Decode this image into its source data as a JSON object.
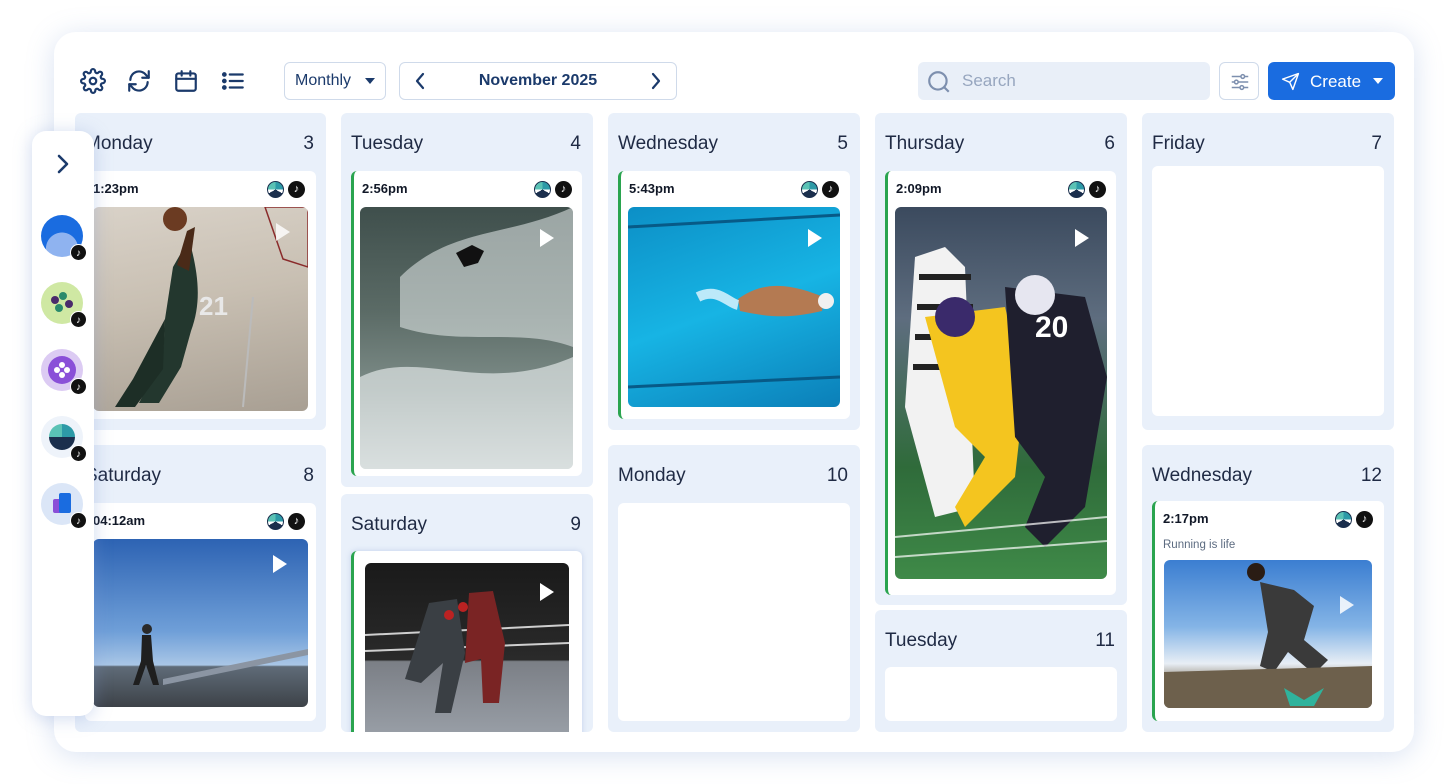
{
  "toolbar": {
    "icons": [
      "gear-icon",
      "refresh-icon",
      "calendar-icon",
      "list-icon"
    ],
    "view_select": "Monthly",
    "month_label": "November 2025",
    "search_placeholder": "Search",
    "create_label": "Create"
  },
  "colors": {
    "accent": "#1a6ce0",
    "day_bg": "#e9f0fa",
    "post_stripe": "#2aa44f"
  },
  "days": [
    {
      "name": "Monday",
      "num": "3",
      "post": {
        "time": "1:23pm",
        "image": "basketball player dunking",
        "video": true
      }
    },
    {
      "name": "Tuesday",
      "num": "4",
      "post": {
        "time": "2:56pm",
        "image": "surfer on wave",
        "video": true
      }
    },
    {
      "name": "Wednesday",
      "num": "5",
      "post": {
        "time": "5:43pm",
        "image": "swimmer in pool",
        "video": true
      }
    },
    {
      "name": "Thursday",
      "num": "6",
      "post": {
        "time": "2:09pm",
        "image": "football players",
        "video": true
      }
    },
    {
      "name": "Friday",
      "num": "7"
    },
    {
      "name": "Saturday",
      "num": "8",
      "post": {
        "time": "04:12am",
        "image": "runner on road",
        "video": true
      }
    },
    {
      "name": "Saturday",
      "num": "9",
      "post": {
        "image": "kickboxers in ring",
        "video": true
      }
    },
    {
      "name": "Monday",
      "num": "10"
    },
    {
      "name": "Tuesday",
      "num": "11"
    },
    {
      "name": "Wednesday",
      "num": "12",
      "post": {
        "time": "2:17pm",
        "caption": "Running is life",
        "image": "athlete jumping",
        "video": true
      }
    }
  ],
  "sidebar": {
    "expand_icon": "chevron-right-icon",
    "accounts": [
      "account-blue-wave",
      "account-green-dots",
      "account-purple-pad",
      "account-brand-mark",
      "account-blue-shapes"
    ]
  }
}
